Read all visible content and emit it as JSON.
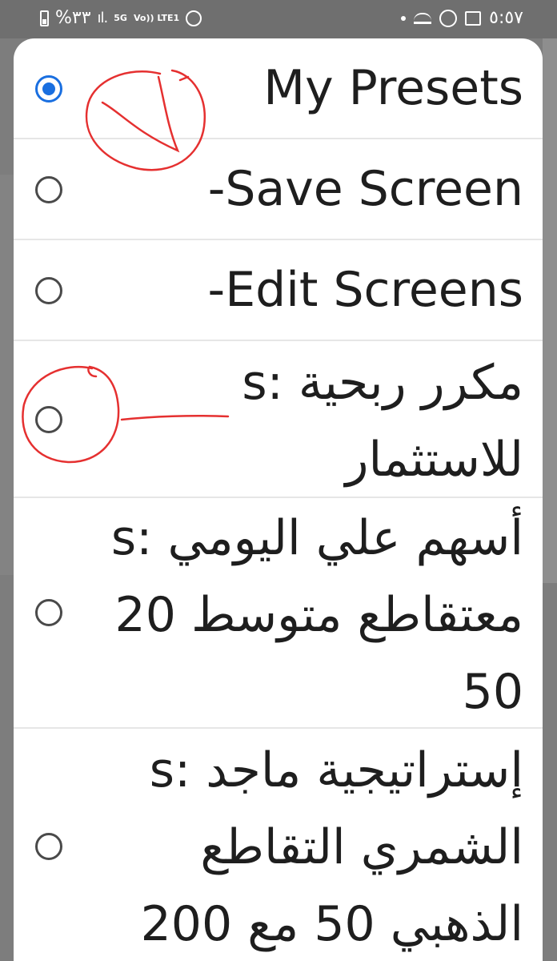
{
  "status_bar": {
    "battery_text": "%٣٣",
    "signal_icon": "signal-bars-icon",
    "net_5g": "5G",
    "net_volte": "Vo)) LTE1",
    "clock": "٥:٥٧"
  },
  "presets_dialog": {
    "options": [
      {
        "label": "My Presets",
        "selected": true
      },
      {
        "label": "-Save Screen",
        "selected": false
      },
      {
        "label": "-Edit Screens",
        "selected": false
      },
      {
        "label": "مكرر ربحية :s للاستثمار",
        "selected": false
      },
      {
        "label": "أسهم علي اليومي :s معتقاطع متوسط 20 50",
        "selected": false
      },
      {
        "label": "إستراتيجية ماجد :s الشمري التقاطع الذهبي 50 مع 200",
        "selected": false
      }
    ]
  },
  "colors": {
    "accent": "#1a6fe0",
    "annotation": "#e53030"
  }
}
